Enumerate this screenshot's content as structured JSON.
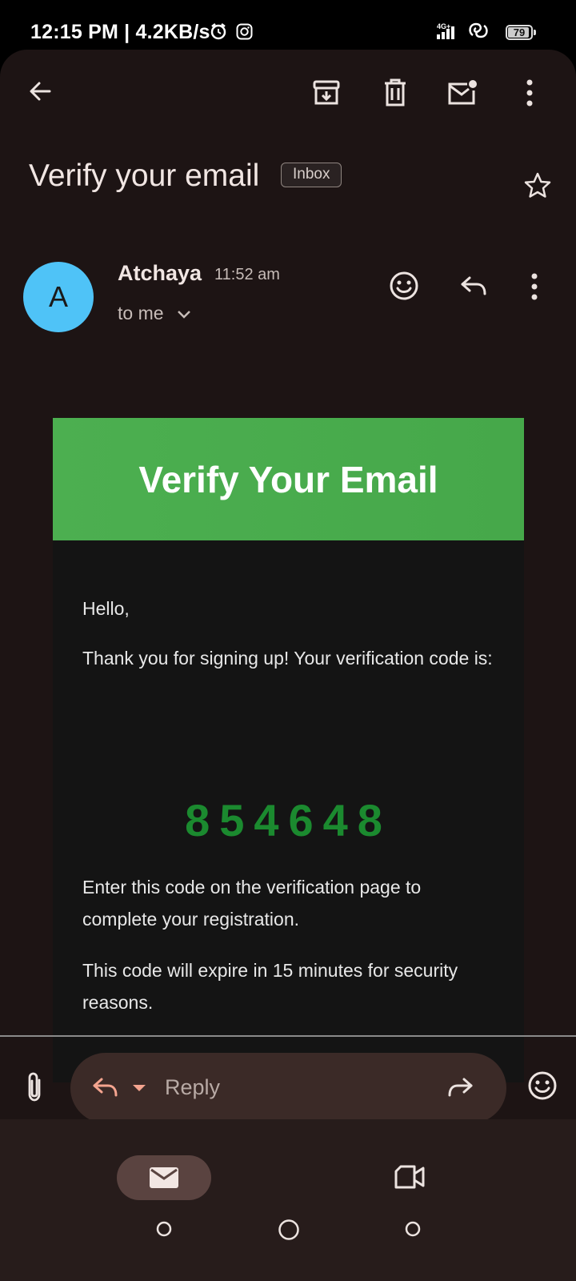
{
  "status_bar": {
    "time": "12:15 PM | 4.2KB/s",
    "network": "4G+",
    "battery": "79",
    "battery_level": 0.79
  },
  "toolbar": {
    "icons": [
      "back-arrow-icon",
      "archive-icon",
      "delete-icon",
      "mark-unread-icon",
      "more-vert-icon"
    ]
  },
  "email": {
    "subject": "Verify your email",
    "label": "Inbox",
    "sender_initial": "A",
    "sender": "Atchaya",
    "time": "11:52 am",
    "recipient": "to me"
  },
  "body": {
    "header_title": "Verify Your Email",
    "greeting": "Hello,",
    "intro": "Thank you for signing up! Your verification code is:",
    "code": "854648",
    "instruction": "Enter this code on the verification page to complete your registration.",
    "expiry": "This code will expire in 15 minutes for security reasons."
  },
  "reply_bar": {
    "placeholder": "Reply"
  },
  "colors": {
    "accent_green": "#4caf50",
    "code_green": "#1b8a2f",
    "avatar_blue": "#4fc3f7",
    "background": "#1d1414"
  }
}
